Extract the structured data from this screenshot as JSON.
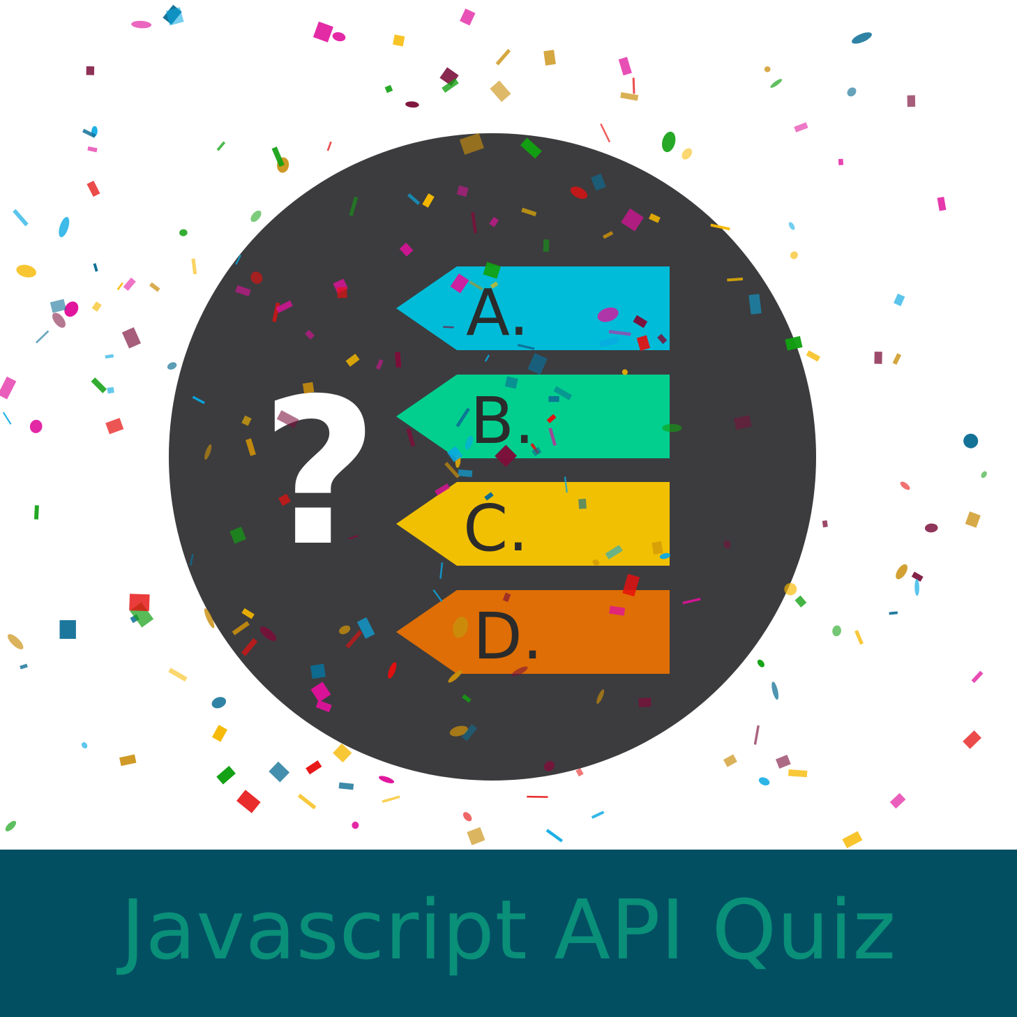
{
  "footer": {
    "title": "Javascript API Quiz"
  },
  "badge": {
    "symbol": "?",
    "circle_color": "#3c3c3e",
    "options": [
      {
        "label": "A.",
        "color": "#00bcd8"
      },
      {
        "label": "B.",
        "color": "#02cf8e"
      },
      {
        "label": "C.",
        "color": "#f1c002"
      },
      {
        "label": "D.",
        "color": "#de6e05"
      }
    ]
  },
  "colors": {
    "footer_bg": "#024f62",
    "footer_text": "#0a8f79",
    "confetti": [
      "#e0119b",
      "#0aa9e3",
      "#f6b800",
      "#12a012",
      "#e60f0f",
      "#0c6d94",
      "#c98e0c",
      "#7b0f3a"
    ]
  }
}
